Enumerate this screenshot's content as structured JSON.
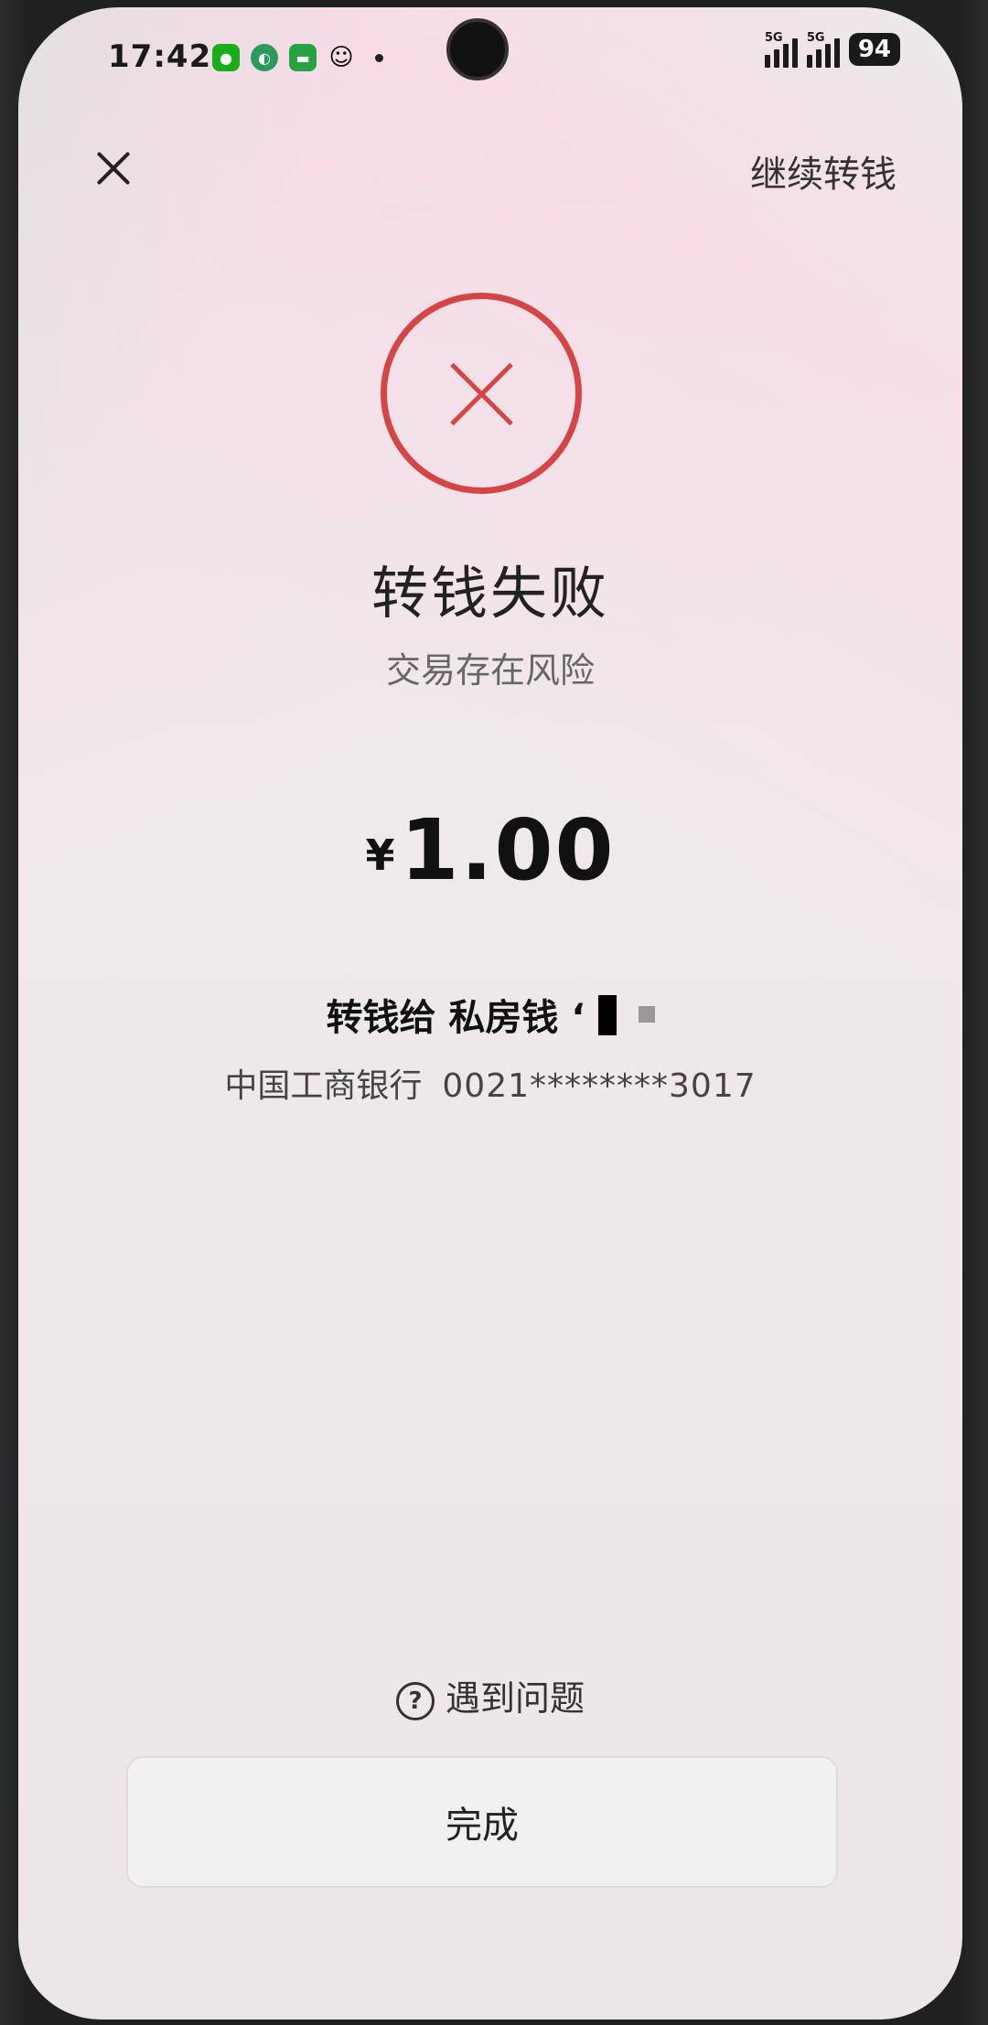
{
  "status_bar": {
    "time": "17:42",
    "notification_icons": [
      "wechat-icon",
      "green-app-icon",
      "green-chat-icon",
      "qq-icon"
    ],
    "network_1": "5G",
    "network_2": "5G",
    "battery": "94"
  },
  "nav": {
    "close_icon": "close-icon",
    "continue_label": "继续转钱"
  },
  "result": {
    "status_icon": "fail-x-icon",
    "title": "转钱失败",
    "reason": "交易存在风险",
    "currency": "¥",
    "amount": "1.00",
    "payee_label": "转钱给 私房钱 ‘",
    "bank_name": "中国工商银行",
    "account": "0021********3017"
  },
  "footer": {
    "help_label": "遇到问题",
    "done_label": "完成"
  },
  "colors": {
    "fail_red": "#d64545",
    "text_primary": "#222222",
    "text_secondary": "#666666"
  }
}
